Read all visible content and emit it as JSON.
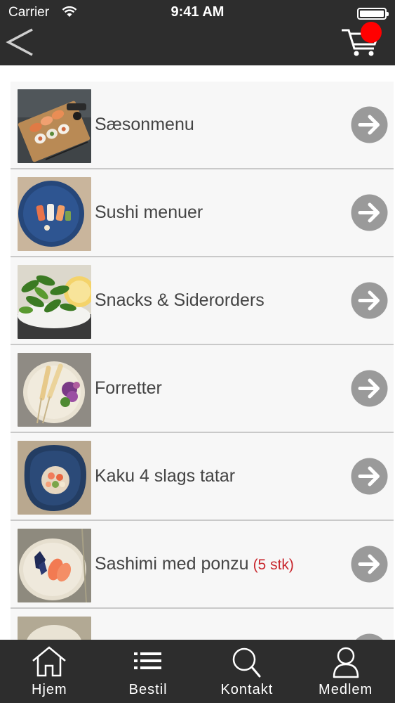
{
  "status_bar": {
    "carrier": "Carrier",
    "time": "9:41 AM"
  },
  "nav": {
    "back_icon": "chevron-left-icon",
    "cart_icon": "shopping-cart-icon"
  },
  "colors": {
    "bar_background": "#2d2d2d",
    "badge": "#ff0000",
    "item_background": "#f7f7f7",
    "arrow": "#9a9a9a",
    "note_red": "#c8262d"
  },
  "menu": {
    "items": [
      {
        "label": "Sæsonmenu",
        "note": ""
      },
      {
        "label": "Sushi menuer",
        "note": ""
      },
      {
        "label": "Snacks & Siderorders",
        "note": ""
      },
      {
        "label": "Forretter",
        "note": ""
      },
      {
        "label": "Kaku 4 slags tatar",
        "note": ""
      },
      {
        "label": "Sashimi med ponzu",
        "note": "(5 stk)"
      },
      {
        "label": "",
        "note": ""
      }
    ]
  },
  "tabs": [
    {
      "label": "Hjem",
      "icon": "home-icon"
    },
    {
      "label": "Bestil",
      "icon": "list-icon"
    },
    {
      "label": "Kontakt",
      "icon": "search-icon"
    },
    {
      "label": "Medlem",
      "icon": "user-icon"
    }
  ]
}
